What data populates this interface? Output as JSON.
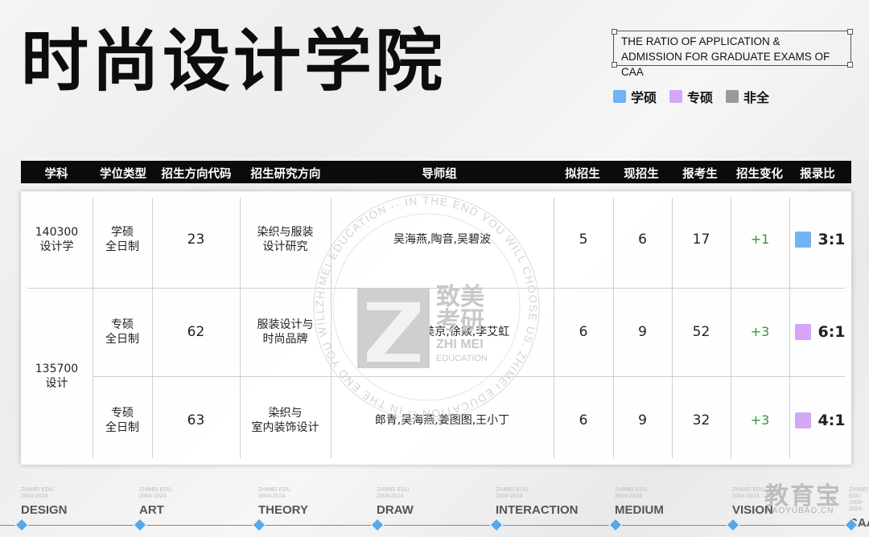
{
  "header": {
    "title": "时尚设计学院",
    "ratio_line1": "THE RATIO OF APPLICATION &",
    "ratio_line2": "ADMISSION FOR GRADUATE EXAMS OF CAA"
  },
  "legend": [
    {
      "label": "学硕",
      "color": "#6fb4f3"
    },
    {
      "label": "专硕",
      "color": "#d3a6f6"
    },
    {
      "label": "非全",
      "color": "#9a9a9a"
    }
  ],
  "table": {
    "columns": [
      "学科",
      "学位类型",
      "招生方向代码",
      "招生研究方向",
      "导师组",
      "拟招生",
      "现招生",
      "报考生",
      "招生变化",
      "报录比"
    ],
    "subjects": [
      {
        "code": "140300",
        "name": "设计学"
      },
      {
        "code": "135700",
        "name": "设计"
      }
    ],
    "rows": [
      {
        "degree_type": "学硕",
        "mode": "全日制",
        "code": "23",
        "dir1": "染织与服装",
        "dir2": "设计研究",
        "advisors": "吴海燕,陶音,吴碧波",
        "planned": "5",
        "current": "6",
        "applicants": "17",
        "change": "+1",
        "ratio": "3:1",
        "ratio_color": "#6fb4f3"
      },
      {
        "degree_type": "专硕",
        "mode": "全日制",
        "code": "62",
        "dir1": "服装设计与",
        "dir2": "时尚品牌",
        "advisors": "凌雅丽,郑美京,徐燚,李艾虹",
        "planned": "6",
        "current": "9",
        "applicants": "52",
        "change": "+3",
        "ratio": "6:1",
        "ratio_color": "#d3a6f6"
      },
      {
        "degree_type": "专硕",
        "mode": "全日制",
        "code": "63",
        "dir1": "染织与",
        "dir2": "室内装饰设计",
        "advisors": "郎青,吴海燕,姜图图,王小丁",
        "planned": "6",
        "current": "9",
        "applicants": "32",
        "change": "+3",
        "ratio": "4:1",
        "ratio_color": "#d3a6f6"
      }
    ]
  },
  "watermark": {
    "ring_text": "ZHIMEI EDUCATION -- IN THE END YOU WILL CHOOSE US. ZHIMEI EDUCATION -- IN THE END YOU WILL CHOOSE US.",
    "logo_cn1": "致美",
    "logo_cn2": "考研",
    "logo_en1": "ZHI MEI",
    "logo_en2": "EDUCATION"
  },
  "footer": {
    "small_top": "ZHIMEI EDU",
    "small_bottom": "2004-2024",
    "items": [
      "DESIGN",
      "ART",
      "THEORY",
      "DRAW",
      "INTERACTION",
      "MEDIUM",
      "VISION",
      "CAA"
    ],
    "brand": "教育宝",
    "brand_url": "JIAOYUBAO.CN"
  }
}
